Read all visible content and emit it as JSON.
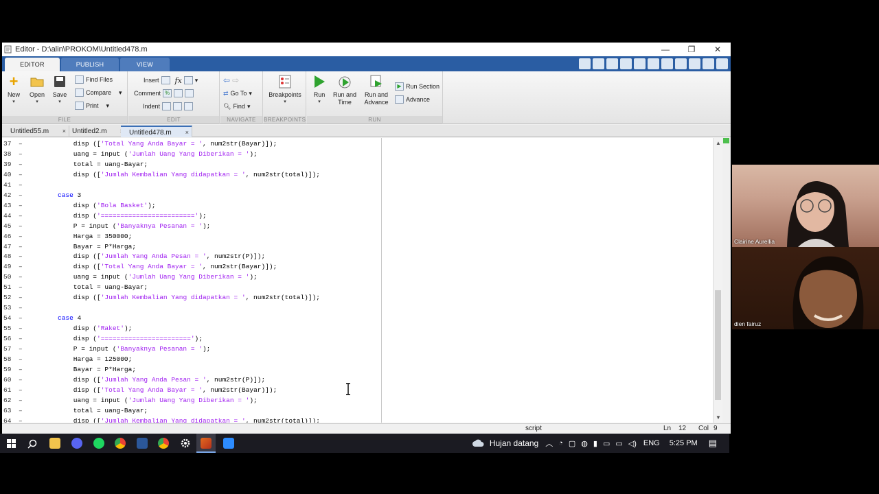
{
  "window": {
    "title": "Editor - D:\\alin\\PROKOM\\Untitled478.m",
    "controls": {
      "minimize": "—",
      "restore": "❐",
      "close": "✕"
    }
  },
  "ribbon_tabs": [
    "EDITOR",
    "PUBLISH",
    "VIEW"
  ],
  "ribbon": {
    "file": {
      "new": "New",
      "open": "Open",
      "save": "Save",
      "find_files": "Find Files",
      "compare": "Compare",
      "print": "Print",
      "label": "FILE"
    },
    "edit": {
      "insert": "Insert",
      "comment": "Comment",
      "indent": "Indent",
      "fx": "fx",
      "label": "EDIT"
    },
    "navigate": {
      "go_to": "Go To",
      "find": "Find",
      "label": "NAVIGATE"
    },
    "breakpoints": {
      "breakpoints": "Breakpoints",
      "label": "BREAKPOINTS"
    },
    "run": {
      "run": "Run",
      "run_and_time_1": "Run and",
      "run_and_time_2": "Time",
      "run_and_advance_1": "Run and",
      "run_and_advance_2": "Advance",
      "run_section": "Run Section",
      "advance": "Advance",
      "label": "RUN"
    }
  },
  "file_tabs": [
    "Untitled55.m",
    "Untitled2.m",
    "Untitled478.m"
  ],
  "file_tab_close": "×",
  "code_lines": [
    {
      "num": "37",
      "segs": [
        [
          "n",
          "    disp (["
        ],
        [
          "s",
          "'Total Yang Anda Bayar = '"
        ],
        [
          "n",
          ", num2str(Bayar)]);"
        ]
      ]
    },
    {
      "num": "38",
      "segs": [
        [
          "n",
          "    uang = input ("
        ],
        [
          "s",
          "'Jumlah Uang Yang Diberikan = '"
        ],
        [
          "n",
          ");"
        ]
      ]
    },
    {
      "num": "39",
      "segs": [
        [
          "n",
          "    total = uang-Bayar;"
        ]
      ]
    },
    {
      "num": "40",
      "segs": [
        [
          "n",
          "    disp (["
        ],
        [
          "s",
          "'Jumlah Kembalian Yang didapatkan = '"
        ],
        [
          "n",
          ", num2str(total)]);"
        ]
      ]
    },
    {
      "num": "41",
      "segs": []
    },
    {
      "num": "42",
      "segs": [
        [
          "k",
          "case"
        ],
        [
          "n",
          " 3"
        ]
      ]
    },
    {
      "num": "43",
      "segs": [
        [
          "n",
          "    disp ("
        ],
        [
          "s",
          "'Bola Basket'"
        ],
        [
          "n",
          ");"
        ]
      ]
    },
    {
      "num": "44",
      "segs": [
        [
          "n",
          "    disp ("
        ],
        [
          "s",
          "'========================'"
        ],
        [
          "n",
          ");"
        ]
      ]
    },
    {
      "num": "45",
      "segs": [
        [
          "n",
          "    P = input ("
        ],
        [
          "s",
          "'Banyaknya Pesanan = '"
        ],
        [
          "n",
          ");"
        ]
      ]
    },
    {
      "num": "46",
      "segs": [
        [
          "n",
          "    Harga = 350000;"
        ]
      ]
    },
    {
      "num": "47",
      "segs": [
        [
          "n",
          "    Bayar = P*Harga;"
        ]
      ]
    },
    {
      "num": "48",
      "segs": [
        [
          "n",
          "    disp (["
        ],
        [
          "s",
          "'Jumlah Yang Anda Pesan = '"
        ],
        [
          "n",
          ", num2str(P)]);"
        ]
      ]
    },
    {
      "num": "49",
      "segs": [
        [
          "n",
          "    disp (["
        ],
        [
          "s",
          "'Total Yang Anda Bayar = '"
        ],
        [
          "n",
          ", num2str(Bayar)]);"
        ]
      ]
    },
    {
      "num": "50",
      "segs": [
        [
          "n",
          "    uang = input ("
        ],
        [
          "s",
          "'Jumlah Uang Yang Diberikan = '"
        ],
        [
          "n",
          ");"
        ]
      ]
    },
    {
      "num": "51",
      "segs": [
        [
          "n",
          "    total = uang-Bayar;"
        ]
      ]
    },
    {
      "num": "52",
      "segs": [
        [
          "n",
          "    disp (["
        ],
        [
          "s",
          "'Jumlah Kembalian Yang didapatkan = '"
        ],
        [
          "n",
          ", num2str(total)]);"
        ]
      ]
    },
    {
      "num": "53",
      "segs": []
    },
    {
      "num": "54",
      "segs": [
        [
          "k",
          "case"
        ],
        [
          "n",
          " 4"
        ]
      ]
    },
    {
      "num": "55",
      "segs": [
        [
          "n",
          "    disp ("
        ],
        [
          "s",
          "'Raket'"
        ],
        [
          "n",
          ");"
        ]
      ]
    },
    {
      "num": "56",
      "segs": [
        [
          "n",
          "    disp ("
        ],
        [
          "s",
          "'======================='"
        ],
        [
          "n",
          ");"
        ]
      ]
    },
    {
      "num": "57",
      "segs": [
        [
          "n",
          "    P = input ("
        ],
        [
          "s",
          "'Banyaknya Pesanan = '"
        ],
        [
          "n",
          ");"
        ]
      ]
    },
    {
      "num": "58",
      "segs": [
        [
          "n",
          "    Harga = 125000;"
        ]
      ]
    },
    {
      "num": "59",
      "segs": [
        [
          "n",
          "    Bayar = P*Harga;"
        ]
      ]
    },
    {
      "num": "60",
      "segs": [
        [
          "n",
          "    disp (["
        ],
        [
          "s",
          "'Jumlah Yang Anda Pesan = '"
        ],
        [
          "n",
          ", num2str(P)]);"
        ]
      ]
    },
    {
      "num": "61",
      "segs": [
        [
          "n",
          "    disp (["
        ],
        [
          "s",
          "'Total Yang Anda Bayar = '"
        ],
        [
          "n",
          ", num2str(Bayar)]);"
        ]
      ]
    },
    {
      "num": "62",
      "segs": [
        [
          "n",
          "    uang = input ("
        ],
        [
          "s",
          "'Jumlah Uang Yang Diberikan = '"
        ],
        [
          "n",
          ");"
        ]
      ]
    },
    {
      "num": "63",
      "segs": [
        [
          "n",
          "    total = uang-Bayar;"
        ]
      ]
    },
    {
      "num": "64",
      "segs": [
        [
          "n",
          "    disp (["
        ],
        [
          "s",
          "'Jumlah Kembalian Yang didapatkan = '"
        ],
        [
          "n",
          ", num2str(total)]);"
        ]
      ]
    }
  ],
  "gutter_marker": "–",
  "status": {
    "type": "script",
    "ln_label": "Ln",
    "ln": "12",
    "col_label": "Col",
    "col": "9"
  },
  "taskbar": {
    "weather": "Hujan datang",
    "lang": "ENG",
    "time": "5:25 PM"
  },
  "participants": [
    {
      "name": "Clairine Aurellia"
    },
    {
      "name": "dien fairuz"
    }
  ],
  "colors": {
    "ribbon_blue": "#2a5da3",
    "keyword": "#0000ff",
    "string": "#a020f0"
  }
}
